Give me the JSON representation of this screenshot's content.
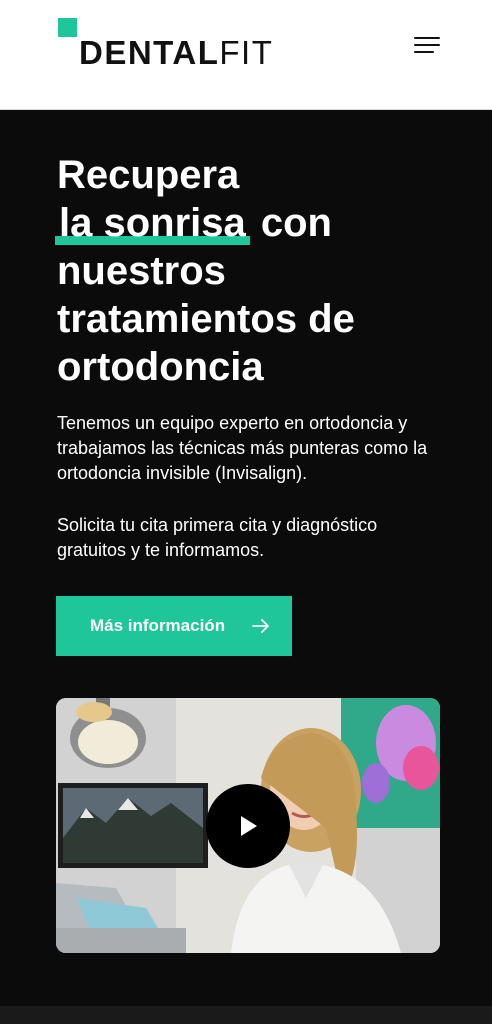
{
  "brand": {
    "name_bold": "DENTAL",
    "name_light": "FIT",
    "accent_color": "#1ec69a"
  },
  "header": {
    "menu_icon": "hamburger-menu-icon"
  },
  "hero": {
    "title_line1": "Recupera",
    "title_highlight": "la sonrisa",
    "title_line2_rest": " con",
    "title_line3": "nuestros",
    "title_line4": "tratamientos de",
    "title_line5": "ortodoncia",
    "paragraph1": "Tenemos un equipo experto en ortodoncia y trabajamos las técnicas más punteras como la ortodoncia invisible (Invisalign).",
    "paragraph2": "Solicita tu cita primera cita y diagnóstico gratuitos y te informamos.",
    "cta_label": "Más información",
    "cta_icon": "arrow-right-icon"
  },
  "video": {
    "thumbnail_icon": "video-thumbnail",
    "play_icon": "play-icon"
  }
}
